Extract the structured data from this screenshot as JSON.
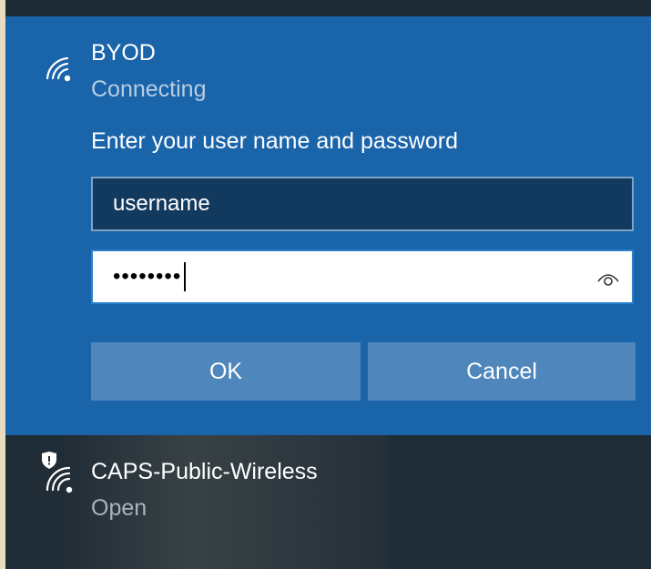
{
  "active_network": {
    "name": "BYOD",
    "status": "Connecting",
    "prompt": "Enter your user name and password",
    "username_value": "username",
    "password_mask": "••••••••",
    "ok_label": "OK",
    "cancel_label": "Cancel"
  },
  "other_networks": [
    {
      "name": "CAPS-Public-Wireless",
      "status": "Open",
      "secured_icon": "shield-icon"
    }
  ],
  "colors": {
    "accent": "#1a64aa",
    "button": "#4f87bd",
    "dark_bg": "#202c36"
  }
}
